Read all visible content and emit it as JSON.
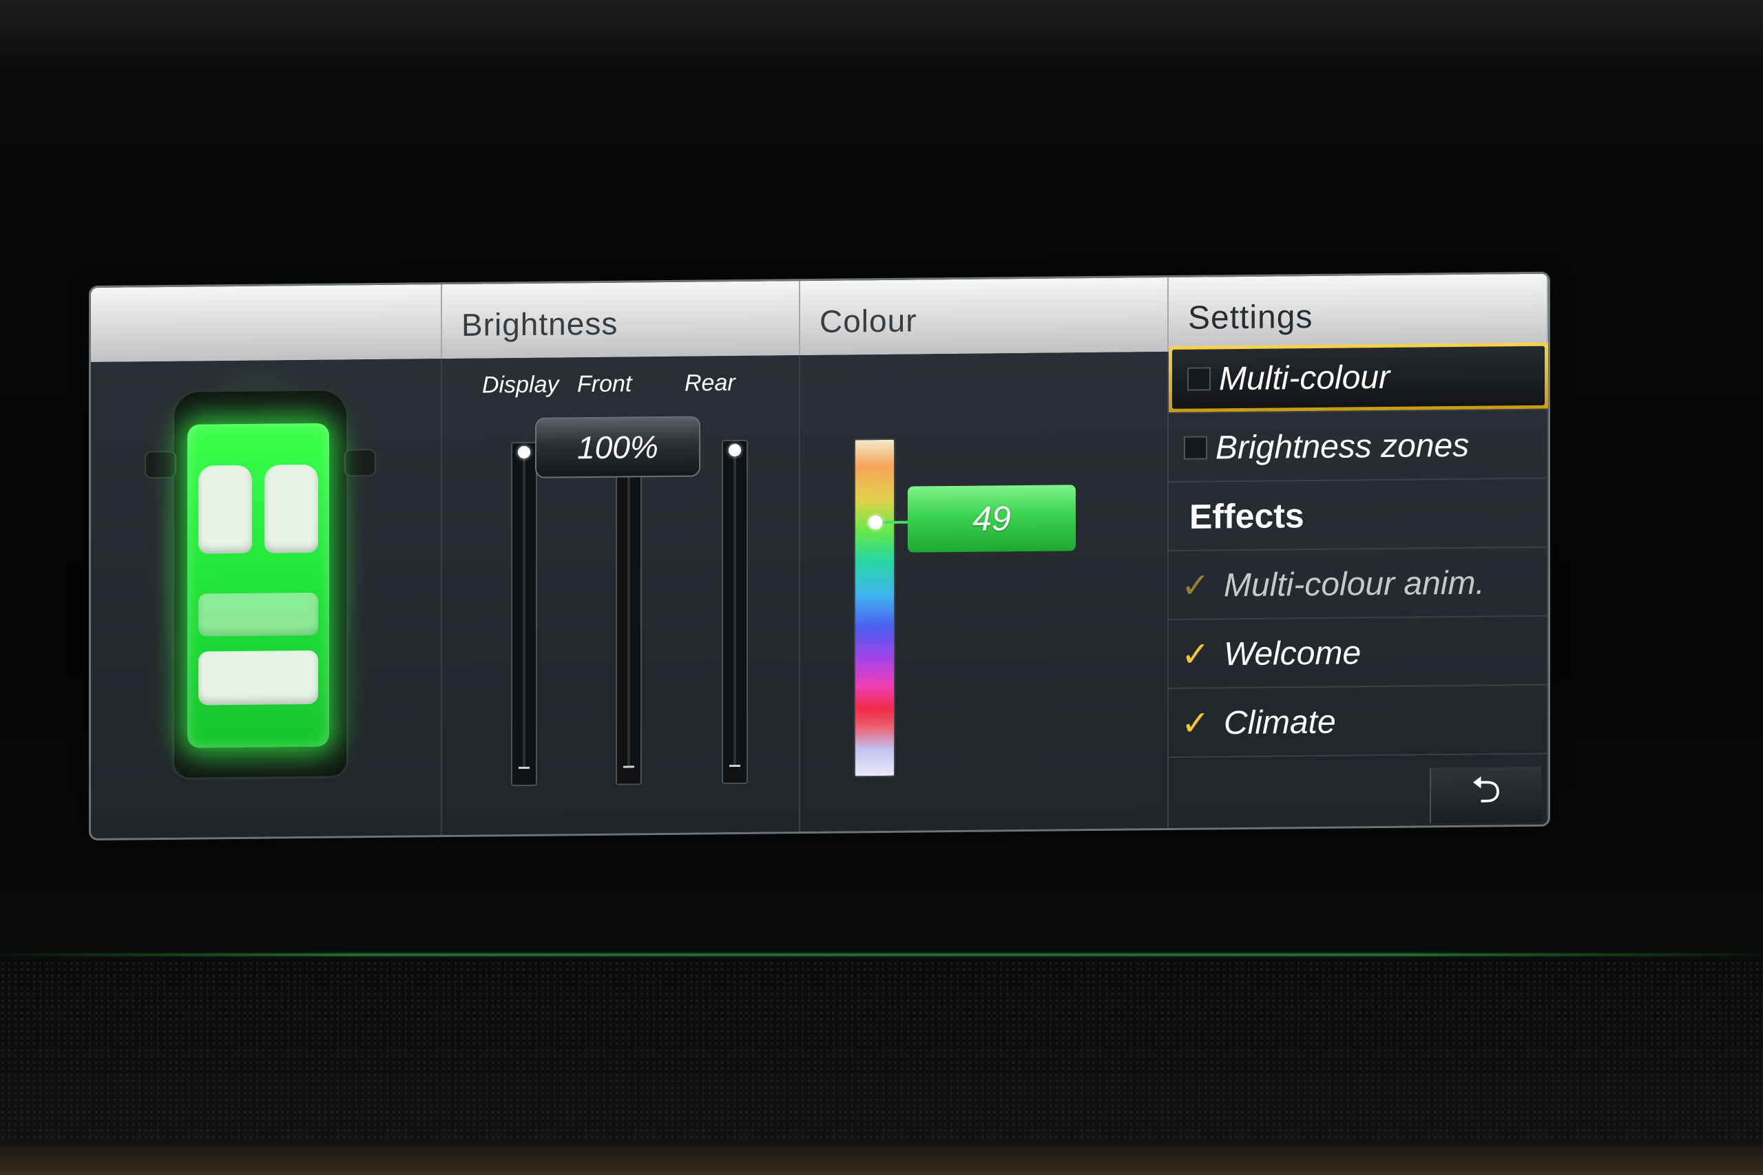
{
  "columns": {
    "car": {
      "title": ""
    },
    "brightness": {
      "title": "Brightness",
      "sliders": [
        {
          "label": "Display",
          "level": 1.0
        },
        {
          "label": "Front",
          "level": 1.0
        },
        {
          "label": "Rear",
          "level": 1.0
        }
      ],
      "value_display": "100%"
    },
    "colour": {
      "title": "Colour",
      "value": "49",
      "indicator_color": "#3bd34f"
    },
    "settings": {
      "title": "Settings",
      "items": [
        {
          "label": "Multi-colour",
          "checked": false,
          "selected": true
        },
        {
          "label": "Brightness zones",
          "checked": false,
          "selected": false
        }
      ],
      "effects_title": "Effects",
      "effects": [
        {
          "label": "Multi-colour anim.",
          "checked": true,
          "enabled": false
        },
        {
          "label": "Welcome",
          "checked": true,
          "enabled": true
        },
        {
          "label": "Climate",
          "checked": true,
          "enabled": true
        }
      ],
      "back_icon": "back-arrow-icon"
    }
  },
  "colors": {
    "ambient_green": "#3cff4a",
    "selection_yellow": "#f6d34a",
    "check_yellow": "#f2c72a"
  }
}
